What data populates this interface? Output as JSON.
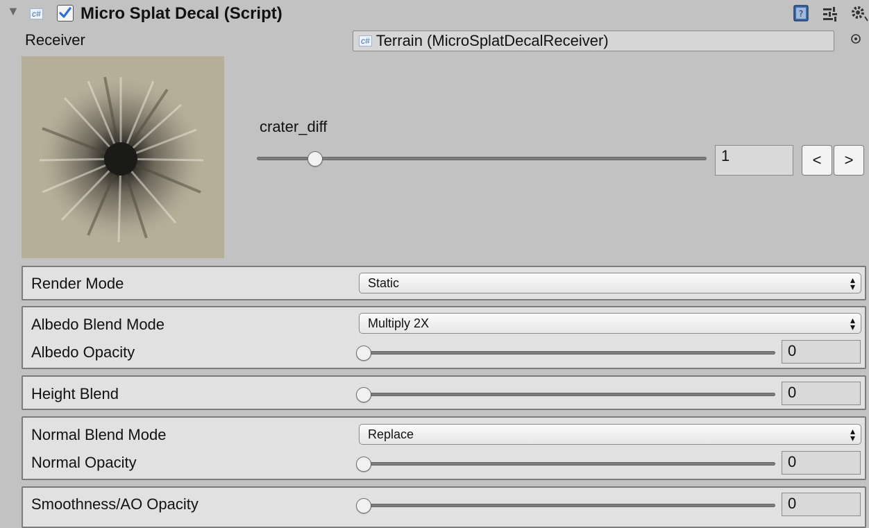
{
  "header": {
    "foldout_glyph": "▼",
    "script_badge": "c#",
    "component_enabled": true,
    "title": "Micro Splat Decal (Script)"
  },
  "receiver": {
    "label": "Receiver",
    "badge": "c#",
    "value": "Terrain (MicroSplatDecalReceiver)"
  },
  "texture": {
    "name": "crater_diff",
    "index": "1",
    "index_slider_fraction": 0.13,
    "prev_label": "<",
    "next_label": ">"
  },
  "render_mode": {
    "label": "Render Mode",
    "value": "Static"
  },
  "albedo": {
    "blend_label": "Albedo Blend Mode",
    "blend_value": "Multiply 2X",
    "opacity_label": "Albedo Opacity",
    "opacity_value": "0"
  },
  "height": {
    "label": "Height Blend",
    "value": "0"
  },
  "normal": {
    "blend_label": "Normal Blend Mode",
    "blend_value": "Replace",
    "opacity_label": "Normal Opacity",
    "opacity_value": "0"
  },
  "smoothness": {
    "label": "Smoothness/AO Opacity",
    "value": "0"
  },
  "icons": {
    "help": "help-book-icon",
    "preset": "preset-sliders-icon",
    "settings": "gear-icon",
    "object_picker": "object-picker-icon",
    "dropdown_arrows": "updown-arrows-icon"
  },
  "colors": {
    "panel_bg": "#c2c2c2",
    "box_bg": "#e1e1e1",
    "checkmark": "#2a6fd6"
  }
}
